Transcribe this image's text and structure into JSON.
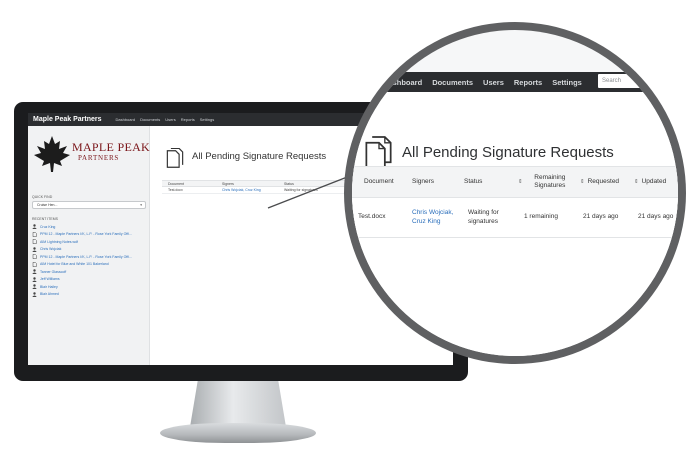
{
  "brand": {
    "name": "Maple Peak Partners",
    "logo_word1": "MAPLE PEAK",
    "logo_word2": "PARTNERS"
  },
  "nav": {
    "items": [
      "Dashboard",
      "Documents",
      "Users",
      "Reports",
      "Settings"
    ],
    "search_placeholder": "Search"
  },
  "sidebar": {
    "quick_label": "Quick Find",
    "select_value": "Cruise Hen...",
    "recent_label": "Recent Items",
    "recent_items": [
      {
        "icon": "user-icon",
        "label": "Cruz King"
      },
      {
        "icon": "document-icon",
        "label": "PPM 12 - Maple Partners I/K, L.P. - Rose York Family Offi..."
      },
      {
        "icon": "document-icon",
        "label": "AIM Lightning Notes.wdf"
      },
      {
        "icon": "user-icon",
        "label": "Chris Wojciak"
      },
      {
        "icon": "document-icon",
        "label": "PPM 12 - Maple Partners I/K, L.P. - Rose York Family Offi..."
      },
      {
        "icon": "document-icon",
        "label": "AIM Hotel for Blue and White 101 Bakerland"
      },
      {
        "icon": "user-icon",
        "label": "Tanner Glasscoff"
      },
      {
        "icon": "user-icon",
        "label": "Jeff Williams"
      },
      {
        "icon": "user-icon",
        "label": "Blair Hailey"
      },
      {
        "icon": "user-icon",
        "label": "Blair Ahmed"
      }
    ]
  },
  "page": {
    "title": "All Pending Signature Requests"
  },
  "table": {
    "columns": [
      "Document",
      "Signers",
      "Status",
      "Remaining Signatures",
      "Requested",
      "Updated"
    ],
    "rows": [
      {
        "document": "Test.docx",
        "signers": "Chris Wojciak, Cruz King",
        "status": "Waiting for signatures",
        "remaining": "1 remaining",
        "requested": "21 days ago",
        "updated": "21 days ago"
      }
    ]
  },
  "colors": {
    "nav_bg": "#2b2d30",
    "link": "#2a6ebb",
    "logo": "#7a1418",
    "frame": "#1b1c1e"
  }
}
